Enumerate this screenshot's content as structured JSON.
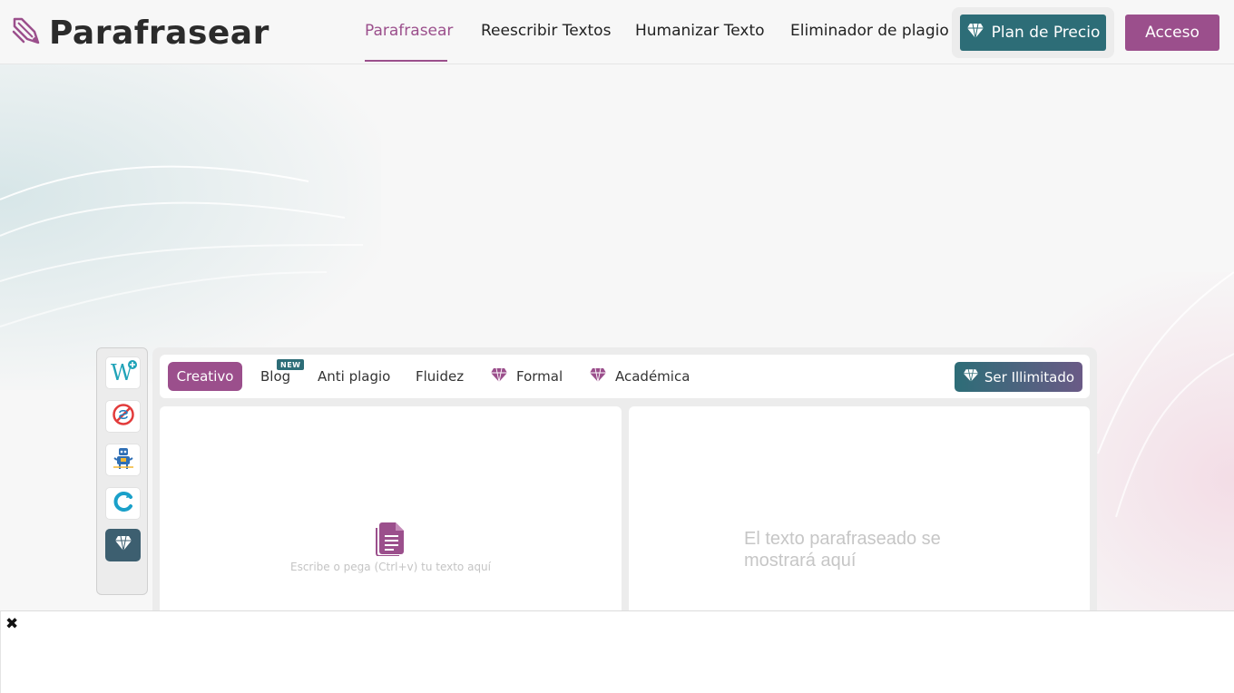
{
  "brand": {
    "name": "Parafrasear",
    "logo_icon": "quill-logo-icon"
  },
  "nav": {
    "items": [
      {
        "label": "Parafrasear",
        "active": true
      },
      {
        "label": "Reescribir Textos",
        "active": false
      },
      {
        "label": "Humanizar Texto",
        "active": false
      },
      {
        "label": "Eliminador de plagio",
        "active": false
      }
    ],
    "plan_label": "Plan de Precio",
    "login_label": "Acceso"
  },
  "tools": {
    "items": [
      {
        "icon": "word-add-icon",
        "active": false
      },
      {
        "icon": "no-plagiarism-icon",
        "active": false
      },
      {
        "icon": "robot-icon",
        "active": false
      },
      {
        "icon": "refresh-c-icon",
        "active": false
      },
      {
        "icon": "diamond-icon",
        "active": true
      }
    ]
  },
  "modes": {
    "items": [
      {
        "label": "Creativo",
        "active": true,
        "premium": false
      },
      {
        "label": "Blog",
        "active": false,
        "premium": false,
        "badge": "NEW"
      },
      {
        "label": "Anti plagio",
        "active": false,
        "premium": false
      },
      {
        "label": "Fluidez",
        "active": false,
        "premium": false
      },
      {
        "label": "Formal",
        "active": false,
        "premium": true
      },
      {
        "label": "Académica",
        "active": false,
        "premium": true
      }
    ],
    "unlimited_label": "Ser Illimitado"
  },
  "editor": {
    "input_placeholder": "Escribe o pega (Ctrl+v) tu texto aquí",
    "output_placeholder": "El texto parafraseado se mostrará aquí"
  },
  "ad_bar": {
    "close_glyph": "✖"
  },
  "colors": {
    "accent": "#9b4f8c",
    "teal": "#2d6d77",
    "background": "#f7f7f7"
  }
}
